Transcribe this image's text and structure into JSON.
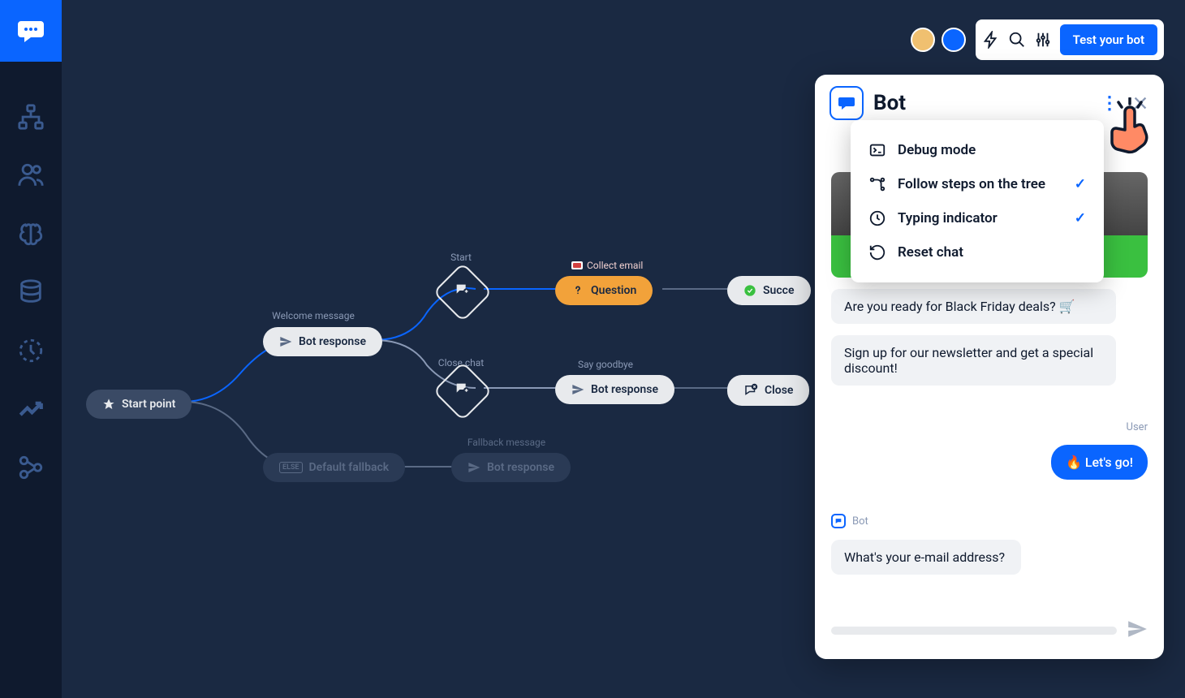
{
  "toolbar": {
    "test_label": "Test your bot"
  },
  "flow": {
    "start_point": "Start point",
    "welcome_label": "Welcome message",
    "welcome_pill": "Bot response",
    "start_label": "Start",
    "close_label": "Close chat",
    "fallback_label": "Fallback message",
    "fallback_pill": "Bot response",
    "question_pill": "Question",
    "collect_email": "Collect email",
    "say_goodbye_label": "Say goodbye",
    "say_goodbye_pill": "Bot response",
    "default_fallback": "Default fallback",
    "success": "Succe",
    "close": "Close"
  },
  "chat": {
    "title": "Bot",
    "messages": {
      "m1": "Are you ready for Black Friday deals? 🛒",
      "m2": "Sign up for our newsletter and get a special discount!",
      "user_label": "User",
      "user_msg": "🔥 Let's go!",
      "bot_label": "Bot",
      "m3": "What's your e-mail address?"
    }
  },
  "dropdown": {
    "debug": "Debug mode",
    "follow": "Follow steps on the tree",
    "typing": "Typing indicator",
    "reset": "Reset chat"
  }
}
